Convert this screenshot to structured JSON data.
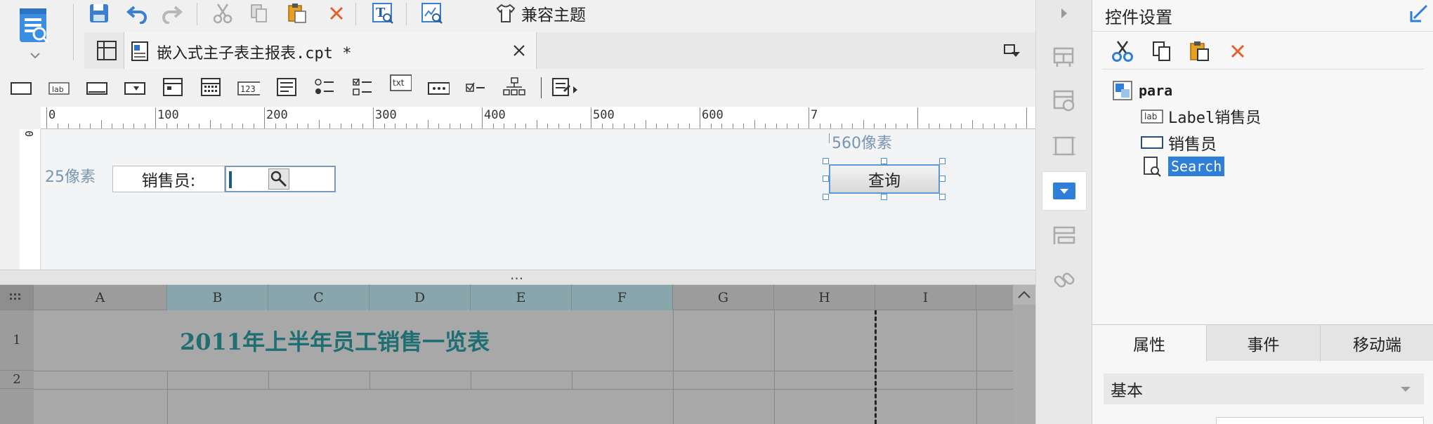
{
  "toolbar": {
    "theme_compat_label": "兼容主题"
  },
  "tabs": [
    {
      "label": "嵌入式主子表主报表.cpt *"
    }
  ],
  "ruler": {
    "marks": [
      "0",
      "100",
      "200",
      "300",
      "400",
      "500",
      "600",
      "7"
    ]
  },
  "canvas": {
    "top_offset_label": "25像素",
    "left_offset_label": "560像素",
    "salesperson_label": "销售员:",
    "query_button_label": "查询"
  },
  "sheet": {
    "columns": [
      "A",
      "B",
      "C",
      "D",
      "E",
      "F",
      "G",
      "H",
      "I"
    ],
    "rows": [
      "1",
      "2"
    ],
    "title": "2011年上半年员工销售一览表"
  },
  "panel": {
    "title": "控件设置",
    "tree": {
      "root": "para",
      "items": [
        {
          "label": "Label销售员",
          "icon": "label-widget-icon"
        },
        {
          "label": "销售员",
          "icon": "textbox-widget-icon"
        },
        {
          "label": "Search",
          "icon": "search-widget-icon",
          "selected": true
        }
      ]
    },
    "tabs": [
      "属性",
      "事件",
      "移动端"
    ],
    "section_label": "基本"
  },
  "colors": {
    "accent": "#2f7fd8",
    "title_teal": "#1e6e72",
    "selected_col_header": "#8aa6ad"
  }
}
